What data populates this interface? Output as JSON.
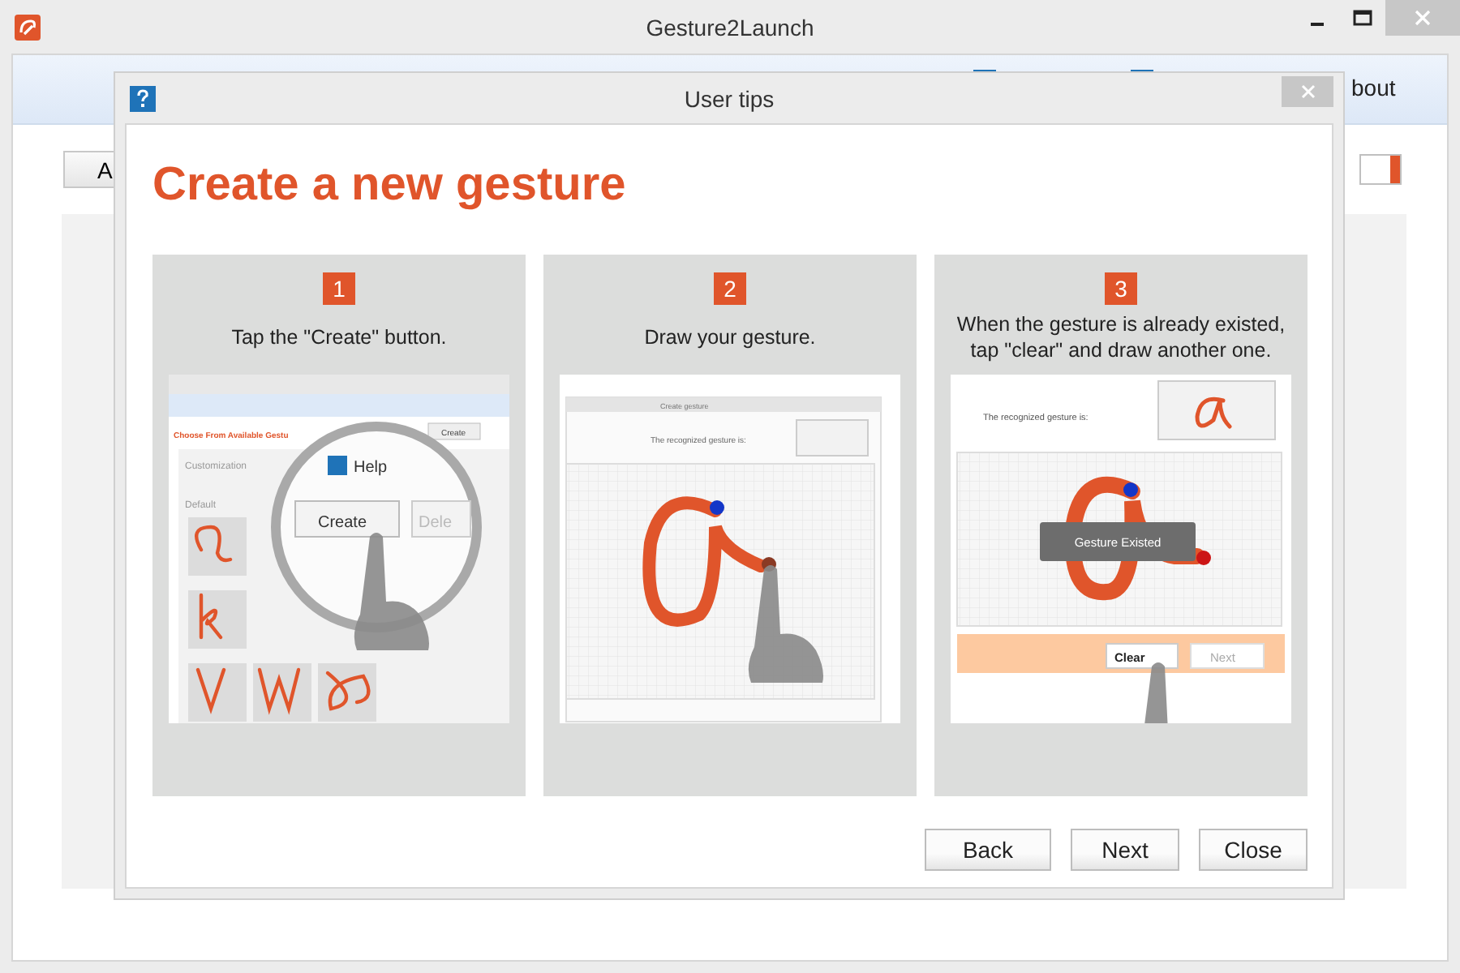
{
  "window": {
    "title": "Gesture2Launch",
    "toolbar_text": "bout",
    "left_button": "A",
    "toggle": {
      "on": true
    }
  },
  "dialog": {
    "title": "User tips",
    "heading": "Create a new gesture",
    "steps": [
      {
        "number": "1",
        "caption": "Tap the \"Create\" button.",
        "kind": "create",
        "texts": [
          "Choose From Available Gestu",
          "Create",
          "Customization",
          "Default",
          "Help",
          "Create",
          "Dele"
        ]
      },
      {
        "number": "2",
        "caption": "Draw your gesture.",
        "kind": "draw",
        "texts": [
          "Create gesture",
          "The recognized gesture is:"
        ]
      },
      {
        "number": "3",
        "caption": "When the gesture is already existed, tap \"clear\" and draw another one.",
        "kind": "clear",
        "texts": [
          "The recognized gesture is:",
          "Gesture Existed",
          "Clear",
          "Next"
        ]
      }
    ],
    "buttons": [
      "Back",
      "Next",
      "Close"
    ]
  }
}
